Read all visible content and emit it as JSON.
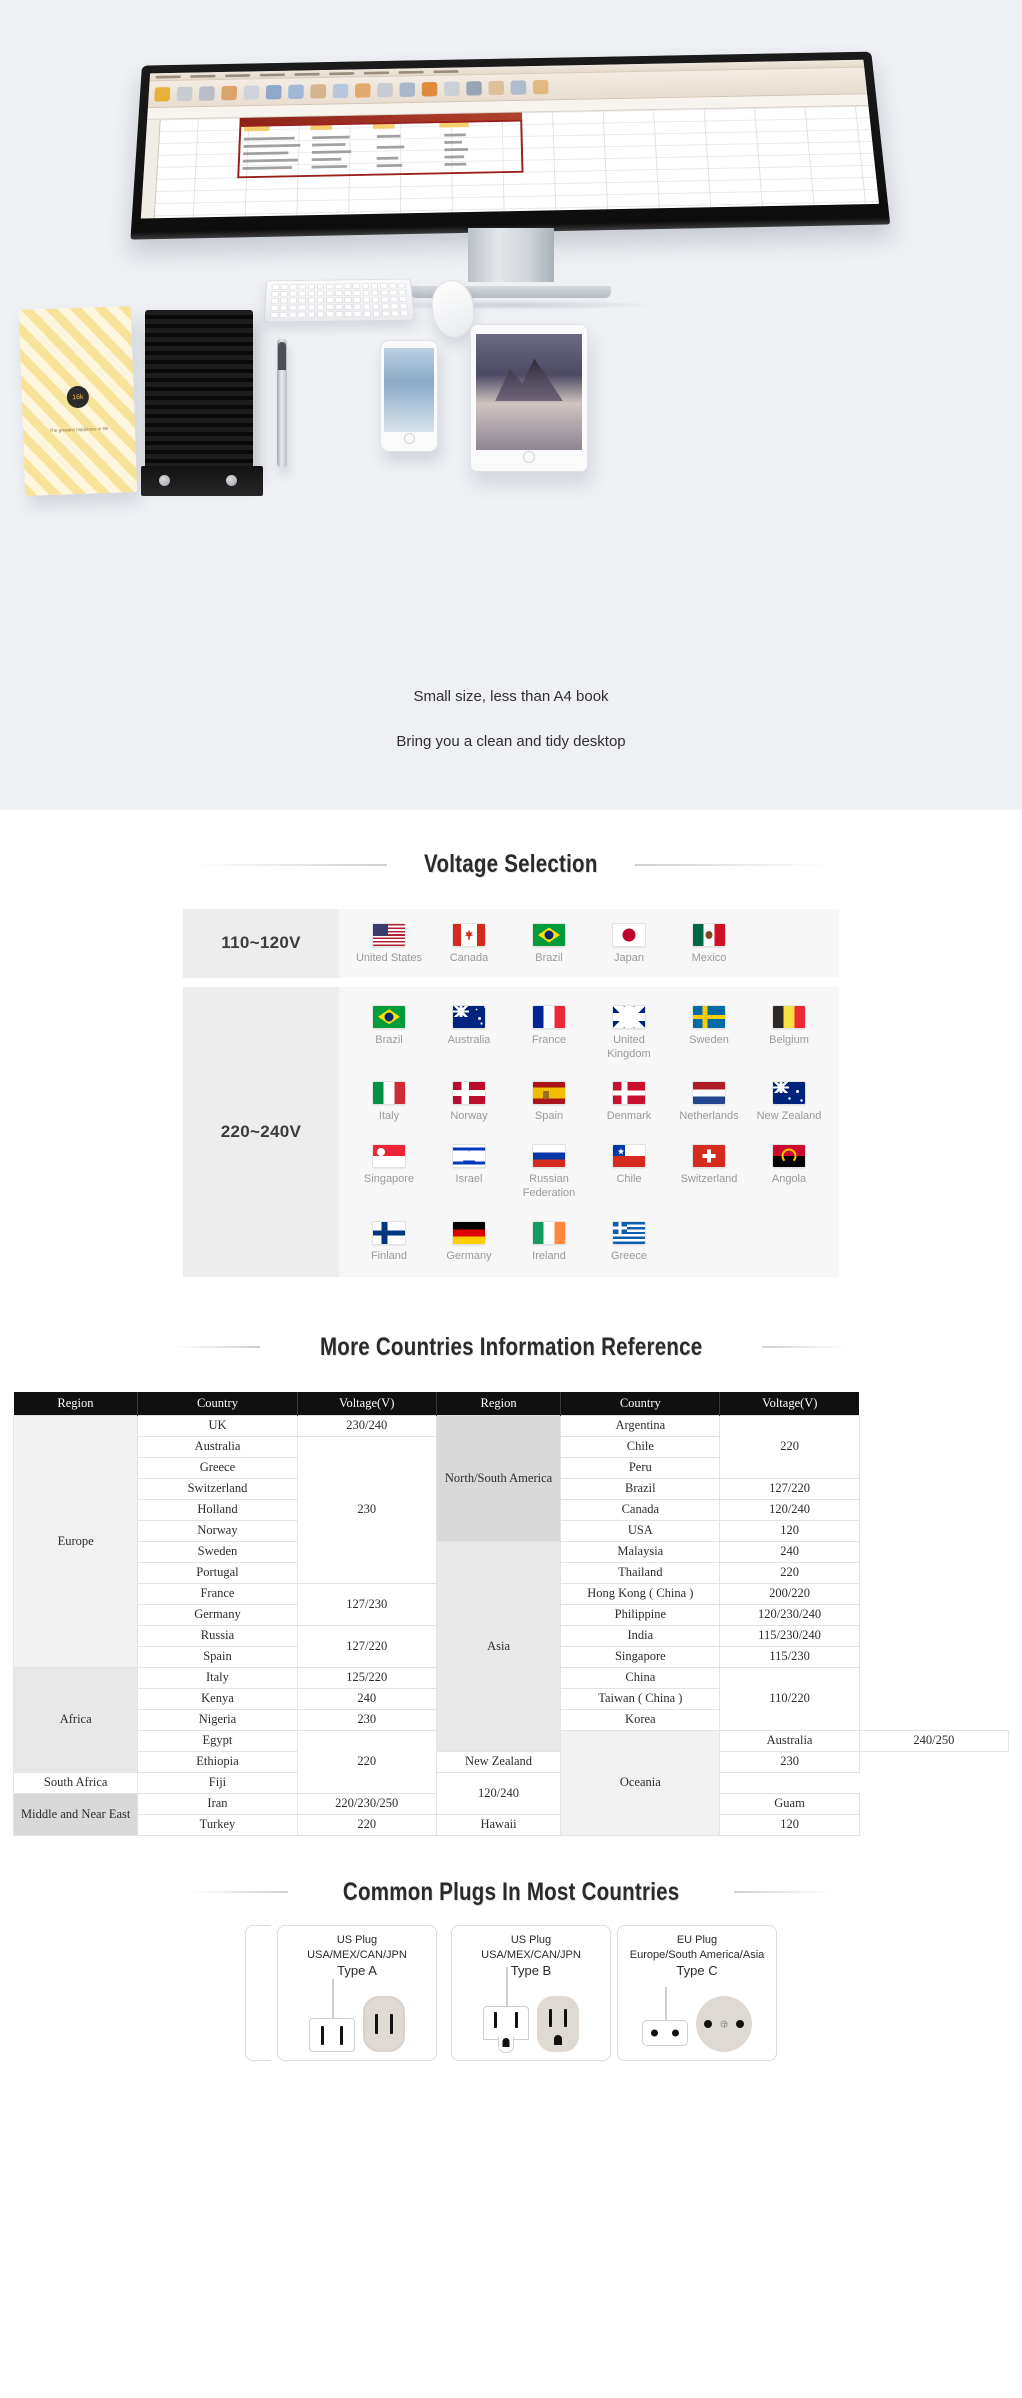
{
  "hero": {
    "caption_line1": "Small size, less than A4 book",
    "caption_line2": "Bring you a clean and tidy desktop",
    "notebook_badge": "16k",
    "notebook_tag": "The greatest happiness in life"
  },
  "voltage_section": {
    "title": "Voltage Selection",
    "rows": [
      {
        "label": "110~120V",
        "countries": [
          {
            "name": "United States",
            "flag": "flag-united-states"
          },
          {
            "name": "Canada",
            "flag": "flag-canada"
          },
          {
            "name": "Brazil",
            "flag": "flag-brazil"
          },
          {
            "name": "Japan",
            "flag": "flag-japan"
          },
          {
            "name": "Mexico",
            "flag": "flag-mexico"
          }
        ]
      },
      {
        "label": "220~240V",
        "countries": [
          {
            "name": "Brazil",
            "flag": "flag-brazil"
          },
          {
            "name": "Australia",
            "flag": "flag-australia"
          },
          {
            "name": "France",
            "flag": "flag-france"
          },
          {
            "name": "United Kingdom",
            "flag": "flag-united-kingdom"
          },
          {
            "name": "Sweden",
            "flag": "flag-sweden"
          },
          {
            "name": "Belgium",
            "flag": "flag-belgium"
          },
          {
            "name": "Italy",
            "flag": "flag-italy"
          },
          {
            "name": "Norway",
            "flag": "flag-norway"
          },
          {
            "name": "Spain",
            "flag": "flag-spain"
          },
          {
            "name": "Denmark",
            "flag": "flag-denmark"
          },
          {
            "name": "Netherlands",
            "flag": "flag-netherlands"
          },
          {
            "name": "New Zealand",
            "flag": "flag-new-zealand"
          },
          {
            "name": "Singapore",
            "flag": "flag-singapore"
          },
          {
            "name": "Israel",
            "flag": "flag-israel"
          },
          {
            "name": "Russian Federation",
            "flag": "flag-russian-federation"
          },
          {
            "name": "Chile",
            "flag": "flag-chile"
          },
          {
            "name": "Switzerland",
            "flag": "flag-switzerland"
          },
          {
            "name": "Angola",
            "flag": "flag-angola"
          },
          {
            "name": "Finland",
            "flag": "flag-finland"
          },
          {
            "name": "Germany",
            "flag": "flag-germany"
          },
          {
            "name": "Ireland",
            "flag": "flag-ireland"
          },
          {
            "name": "Greece",
            "flag": "flag-greece"
          }
        ]
      }
    ]
  },
  "countries_table": {
    "title": "More Countries Information Reference",
    "headers": [
      "Region",
      "Country",
      "Voltage(V)",
      "Region",
      "Country",
      "Voltage(V)"
    ],
    "left": {
      "regions": [
        {
          "name": "Europe",
          "rowspan": 12
        },
        {
          "name": "Africa",
          "rowspan": 5
        },
        {
          "name": "Middle and Near East",
          "rowspan": 2
        }
      ],
      "countries": [
        "UK",
        "Australia",
        "Greece",
        "Switzerland",
        "Holland",
        "Norway",
        "Sweden",
        "Portugal",
        "France",
        "Germany",
        "Russia",
        "Spain",
        "Italy",
        "Kenya",
        "Nigeria",
        "Egypt",
        "Ethiopia",
        "South Africa",
        "Iran",
        "Turkey"
      ],
      "voltages": [
        {
          "value": "230/240",
          "rowspan": 1
        },
        {
          "value": "230",
          "rowspan": 7
        },
        {
          "value": "127/230",
          "rowspan": 2
        },
        {
          "value": "127/220",
          "rowspan": 2
        },
        {
          "value": "125/220",
          "rowspan": 1
        },
        {
          "value": "240",
          "rowspan": 1
        },
        {
          "value": "230",
          "rowspan": 1
        },
        {
          "value": "220",
          "rowspan": 3
        },
        {
          "value": "220/230/250",
          "rowspan": 1
        },
        {
          "value": "230",
          "rowspan": 1
        },
        {
          "value": "220",
          "rowspan": 1
        }
      ]
    },
    "right": {
      "regions": [
        {
          "name": "North/South America",
          "rowspan": 6
        },
        {
          "name": "Asia",
          "rowspan": 10
        },
        {
          "name": "Oceania",
          "rowspan": 5
        }
      ],
      "countries": [
        "Argentina",
        "Chile",
        "Peru",
        "Brazil",
        "Canada",
        "USA",
        "Malaysia",
        "Thailand",
        "Hong Kong ( China )",
        "Philippine",
        "India",
        "Singapore",
        "China",
        "Taiwan ( China )",
        "Korea",
        "Australia",
        "New Zealand",
        "Fiji",
        "Guam",
        "Hawaii"
      ],
      "voltages": [
        {
          "value": "220",
          "rowspan": 3
        },
        {
          "value": "127/220",
          "rowspan": 1
        },
        {
          "value": "120/240",
          "rowspan": 1
        },
        {
          "value": "120",
          "rowspan": 1
        },
        {
          "value": "240",
          "rowspan": 1
        },
        {
          "value": "220",
          "rowspan": 1
        },
        {
          "value": "200/220",
          "rowspan": 1
        },
        {
          "value": "120/230/240",
          "rowspan": 1
        },
        {
          "value": "115/230/240",
          "rowspan": 1
        },
        {
          "value": "115/230",
          "rowspan": 1
        },
        {
          "value": "110/220",
          "rowspan": 3
        },
        {
          "value": "240/250",
          "rowspan": 1
        },
        {
          "value": "230",
          "rowspan": 1
        },
        {
          "value": "120/240",
          "rowspan": 2
        },
        {
          "value": "120",
          "rowspan": 1
        }
      ]
    }
  },
  "plugs_section": {
    "title": "Common Plugs In Most Countries",
    "plugs": [
      {
        "name": "US Plug",
        "regions": "USA/MEX/CAN/JPN",
        "type": "Type A"
      },
      {
        "name": "US Plug",
        "regions": "USA/MEX/CAN/JPN",
        "type": "Type B"
      },
      {
        "name": "EU Plug",
        "regions": "Europe/South America/Asia",
        "type": "Type C"
      }
    ]
  },
  "colors": {
    "hero_bg": "#eef0f4",
    "header_bar": "#101010",
    "label_bg": "#ededed",
    "cell_bg": "#f7f7f7",
    "title_text": "#2a2a2a",
    "flag_label": "#9a9a9a"
  }
}
